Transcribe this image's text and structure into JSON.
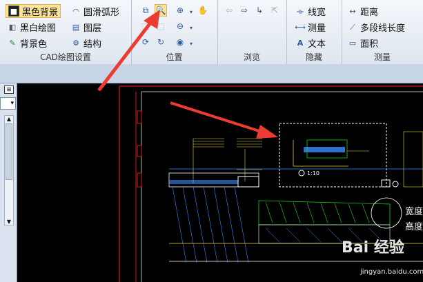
{
  "ribbon": {
    "groups": [
      {
        "id": "cad",
        "label": "CAD绘图设置",
        "buttons": [
          {
            "label": "黑色背景",
            "icon": "black-bg-icon",
            "active": true
          },
          {
            "label": "圆滑弧形",
            "icon": "smooth-arc-icon"
          },
          {
            "label": "黑白绘图",
            "icon": "bw-draw-icon"
          },
          {
            "label": "图层",
            "icon": "layers-icon"
          },
          {
            "label": "背景色",
            "icon": "bg-color-icon"
          },
          {
            "label": "结构",
            "icon": "structure-icon"
          }
        ]
      },
      {
        "id": "position",
        "label": "位置"
      },
      {
        "id": "browse",
        "label": "浏览"
      },
      {
        "id": "hide",
        "label": "隐藏",
        "buttons": [
          {
            "label": "线宽",
            "icon": "line-width-icon"
          },
          {
            "label": "测量",
            "icon": "measure-icon"
          },
          {
            "label": "文本",
            "icon": "text-icon"
          }
        ]
      },
      {
        "id": "measure",
        "label": "测量",
        "buttons": [
          {
            "label": "距离",
            "icon": "distance-icon"
          },
          {
            "label": "多段线长度",
            "icon": "polyline-length-icon"
          },
          {
            "label": "面积",
            "icon": "area-icon"
          }
        ]
      }
    ]
  },
  "drawing": {
    "detail_label": "1:10",
    "side_labels": [
      "宽度",
      "高度"
    ]
  },
  "watermark": {
    "logo": "Bai 经验",
    "url": "jingyan.baidu.com"
  },
  "colors": {
    "annotation_arrow": "#ec3b32",
    "canvas_bg": "#000000",
    "drawing_frame": "#d22020",
    "hatch_green": "#18d418",
    "hatch_blue": "#3b8cff",
    "dim_yellow": "#e8d44a"
  }
}
